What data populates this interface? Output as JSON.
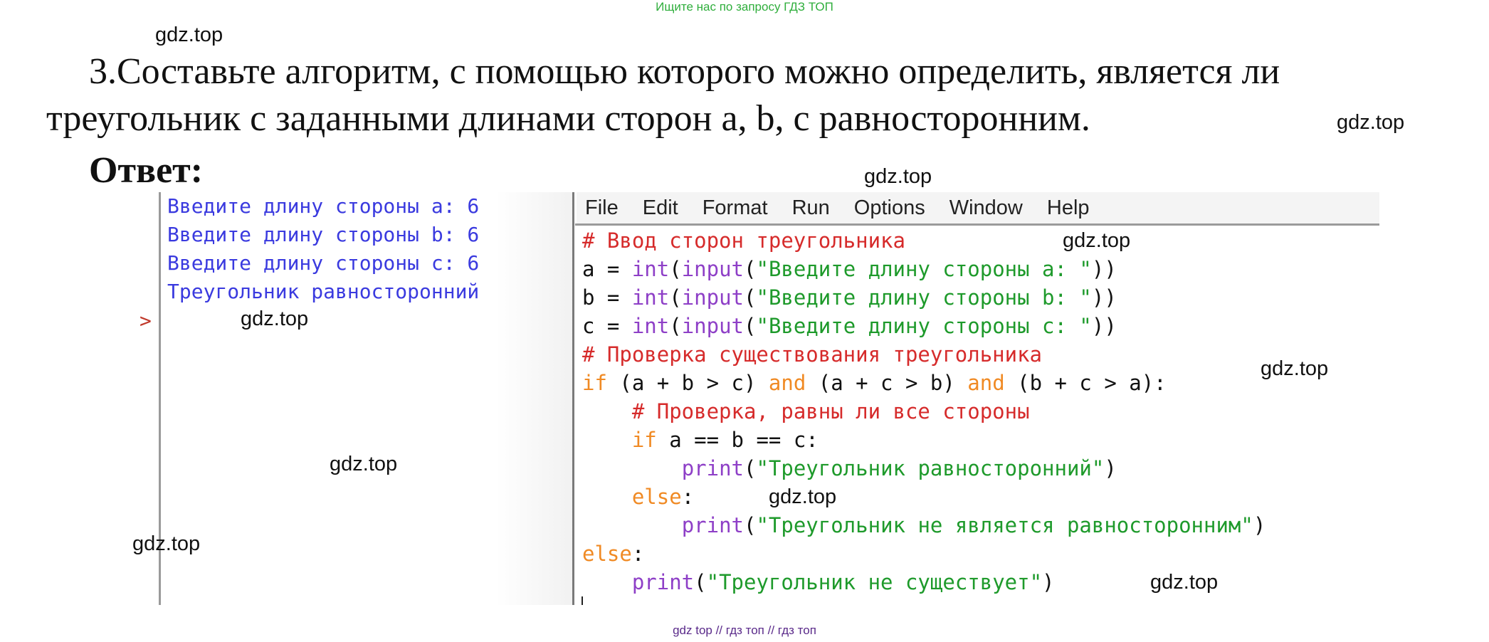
{
  "header_note": "Ищите нас по запросу ГДЗ ТОП",
  "watermark": "gdz.top",
  "task": {
    "line1": "3.Составьте алгоритм, с помощью которого можно определить, является ли",
    "line2": "треугольник с заданными длинами сторон a, b, c равносторонним."
  },
  "answer_label": "Ответ:",
  "shell": {
    "lines": [
      "Введите длину стороны a: 6",
      "Введите длину стороны b: 6",
      "Введите длину стороны c: 6",
      "Треугольник равносторонний"
    ],
    "prompt": ">"
  },
  "editor": {
    "menu": [
      "File",
      "Edit",
      "Format",
      "Run",
      "Options",
      "Window",
      "Help"
    ],
    "code": {
      "c1": "# Ввод сторон треугольника",
      "a_var": "a = ",
      "b_var": "b = ",
      "c_var": "c = ",
      "int_fn": "int",
      "input_fn": "input",
      "open_paren": "(",
      "close_parens": "))",
      "str_a": "\"Введите длину стороны a: \"",
      "str_b": "\"Введите длину стороны b: \"",
      "str_c": "\"Введите длину стороны c: \"",
      "c2": "# Проверка существования треугольника",
      "if_kw": "if",
      "cond1": " (a + b > c) ",
      "and_kw": "and",
      "cond2": " (a + c > b) ",
      "cond3": " (b + c > a):",
      "c3": "# Проверка, равны ли все стороны",
      "cond_eq": " a == b == c:",
      "print_fn": "print",
      "str_eq": "\"Треугольник равносторонний\"",
      "close_paren": ")",
      "else_kw": "else",
      "colon": ":",
      "str_not_eq": "\"Треугольник не является равносторонним\"",
      "str_not_exist": "\"Треугольник не существует\""
    }
  },
  "bottom_note": "gdz top  //  гдз топ  //  гдз топ"
}
